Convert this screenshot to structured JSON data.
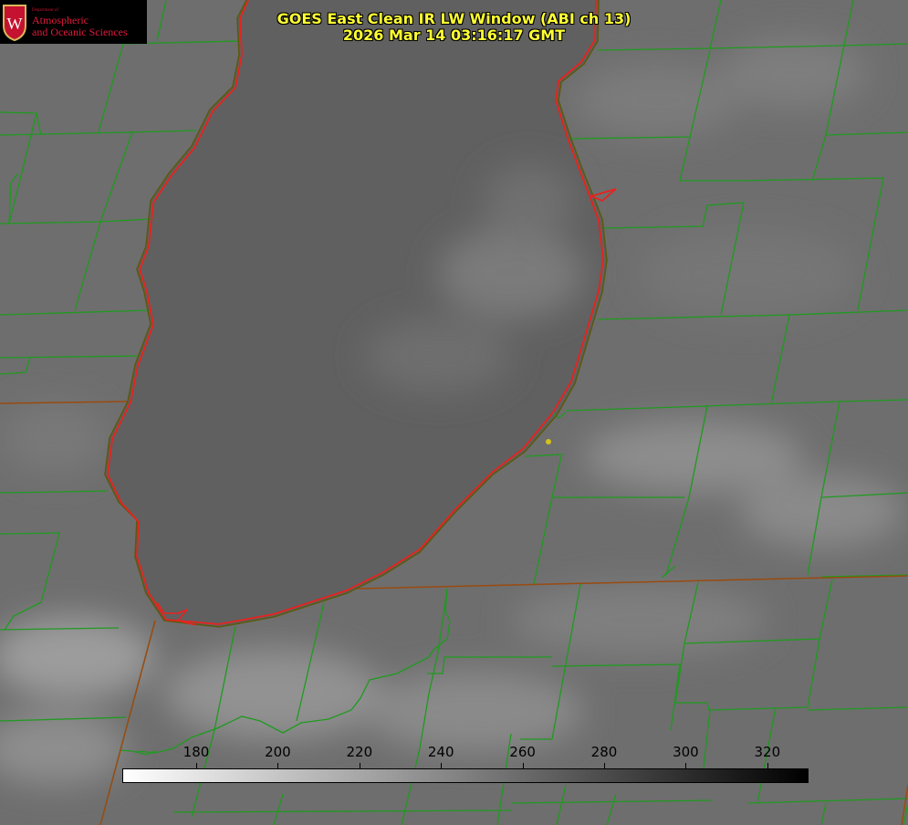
{
  "title": {
    "line1": "GOES East Clean IR LW Window (ABI ch 13)",
    "line2": "2026 Mar 14 03:16:17 GMT"
  },
  "logo": {
    "dept": "Department of",
    "line1": "Atmospheric",
    "line2": "and Oceanic Sciences",
    "seal_text": "W"
  },
  "colorbar": {
    "ticks": [
      "180",
      "200",
      "220",
      "240",
      "260",
      "280",
      "300",
      "320"
    ]
  },
  "colors": {
    "county_lines": "#1f9a1f",
    "shoreline": "#e8221e",
    "title_text": "#ffff33",
    "marker": "#d4c21a"
  }
}
